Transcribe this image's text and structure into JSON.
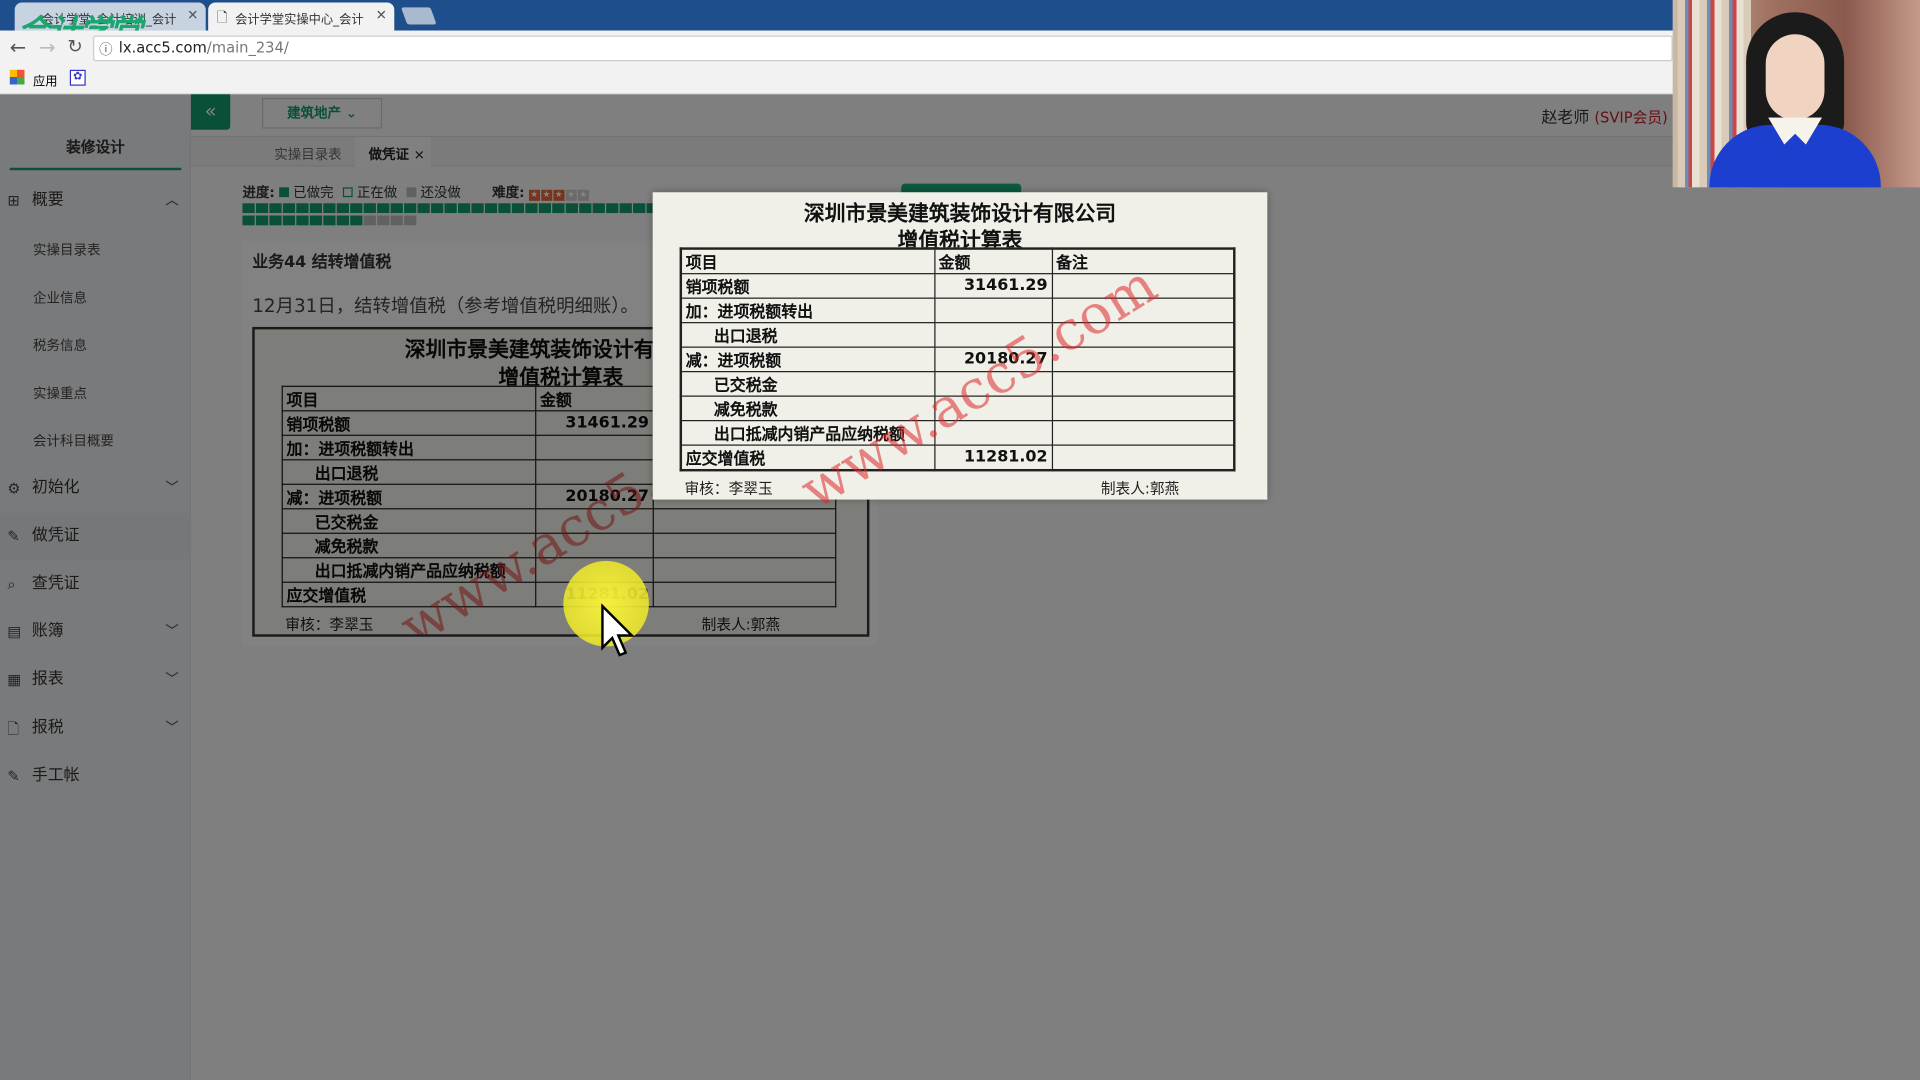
{
  "browser": {
    "tabs": [
      {
        "label": "会计学堂_会计培训_会计",
        "active": false
      },
      {
        "label": "会计学堂实操中心_会计",
        "active": true
      }
    ],
    "logo_text": "会计学堂",
    "url_host": "lx.acc5.com",
    "url_path": "/main_234/",
    "bookmarks": [
      {
        "label": "应用",
        "icon": "apps-grid-icon"
      },
      {
        "label": "",
        "icon": "baidu-paw-icon"
      }
    ]
  },
  "sidebar": {
    "title": "装修设计",
    "items": [
      {
        "label": "概要",
        "icon": "grid-icon",
        "chevron": "up",
        "children": [
          "实操目录表",
          "企业信息",
          "税务信息",
          "实操重点",
          "会计科目概要"
        ]
      },
      {
        "label": "初始化",
        "icon": "gear-icon",
        "chevron": "down"
      },
      {
        "label": "做凭证",
        "icon": "pencil-icon",
        "active": true
      },
      {
        "label": "查凭证",
        "icon": "search-icon"
      },
      {
        "label": "账簿",
        "icon": "ledger-icon",
        "chevron": "down"
      },
      {
        "label": "报表",
        "icon": "report-icon",
        "chevron": "down"
      },
      {
        "label": "报税",
        "icon": "file-icon",
        "chevron": "down"
      },
      {
        "label": "手工帐",
        "icon": "pencil-icon"
      }
    ]
  },
  "header": {
    "collapse_icon": "double-chevron-left-icon",
    "industry_select": "建筑地产",
    "user_name": "赵老师",
    "user_badge": "(SVIP会员)",
    "tabs": [
      {
        "label": "实操目录表"
      },
      {
        "label": "做凭证",
        "active": true,
        "closable": true
      }
    ]
  },
  "progress": {
    "label": "进度:",
    "legend": [
      "已做完",
      "正在做",
      "还没做"
    ],
    "difficulty_label": "难度:",
    "difficulty_stars": 3,
    "difficulty_max": 5,
    "done_count": 40,
    "todo_count": 4
  },
  "task": {
    "title": "业务44 结转增值税",
    "description": "12月31日，结转增值税（参考增值税明细账）。"
  },
  "vat_sheet": {
    "company": "深圳市景美建筑装饰设计有限公司",
    "title": "增值税计算表",
    "headers": [
      "项目",
      "金额",
      "备注"
    ],
    "rows": [
      {
        "item": "销项税额",
        "amount": "31461.29",
        "indent": false
      },
      {
        "item": "加：进项税额转出",
        "amount": "",
        "indent": false
      },
      {
        "item": "出口退税",
        "amount": "",
        "indent": true
      },
      {
        "item": "减：进项税额",
        "amount": "20180.27",
        "indent": false
      },
      {
        "item": "已交税金",
        "amount": "",
        "indent": true
      },
      {
        "item": "减免税款",
        "amount": "",
        "indent": true
      },
      {
        "item": "出口抵减内销产品应纳税额",
        "amount": "",
        "indent": true
      },
      {
        "item": "应交增值税",
        "amount": "11281.02",
        "indent": false
      }
    ],
    "reviewer": "审核：李翠玉",
    "preparer": "制表人:郭燕",
    "watermark": "www.acc5.com"
  },
  "colors": {
    "brand_green": "#14976a",
    "badge_red": "#c0202a",
    "star_orange": "#e0663a"
  }
}
